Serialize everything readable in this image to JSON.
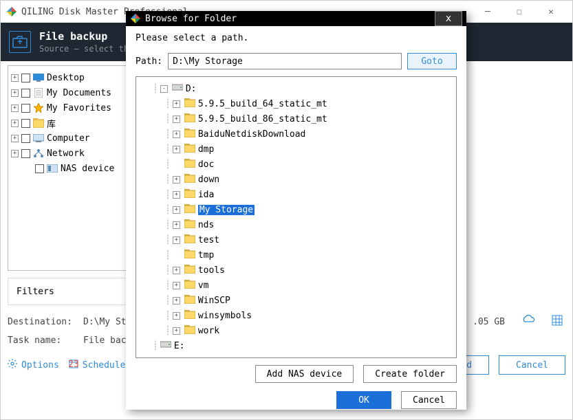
{
  "main": {
    "title": "QILING Disk Master Professional",
    "header_title": "File backup",
    "header_sub": "Source — select the files and folders you want to backup"
  },
  "left_tree": [
    {
      "expand": "+",
      "label": "Desktop",
      "icon": "desktop"
    },
    {
      "expand": "+",
      "label": "My Documents",
      "icon": "doc"
    },
    {
      "expand": "+",
      "label": "My Favorites",
      "icon": "star"
    },
    {
      "expand": "+",
      "label": "库",
      "icon": "lib"
    },
    {
      "expand": "+",
      "label": "Computer",
      "icon": "computer"
    },
    {
      "expand": "+",
      "label": "Network",
      "icon": "network"
    },
    {
      "expand": "",
      "label": "NAS device",
      "icon": "nas",
      "indent": true
    }
  ],
  "filters_label": "Filters",
  "dest": {
    "label": "Destination:",
    "value": "D:\\My Storage",
    "free": ".05 GB"
  },
  "task": {
    "label": "Task name:",
    "value": "File backup"
  },
  "bottom": {
    "options": "Options",
    "schedule": "Schedule",
    "proceed_partial": "eed",
    "cancel": "Cancel"
  },
  "dialog": {
    "title": "Browse for Folder",
    "prompt": "Please select a path.",
    "path_label": "Path:",
    "path_value": "D:\\My Storage",
    "goto": "Goto",
    "add_nas": "Add NAS device",
    "create_folder": "Create folder",
    "ok": "OK",
    "cancel": "Cancel"
  },
  "dlg_tree": {
    "drive_d": "D:",
    "children": [
      {
        "label": "5.9.5_build_64_static_mt",
        "exp": "+"
      },
      {
        "label": "5.9.5_build_86_static_mt",
        "exp": "+"
      },
      {
        "label": "BaiduNetdiskDownload",
        "exp": "+"
      },
      {
        "label": "dmp",
        "exp": "+"
      },
      {
        "label": "doc",
        "exp": ""
      },
      {
        "label": "down",
        "exp": "+"
      },
      {
        "label": "ida",
        "exp": "+"
      },
      {
        "label": "My Storage",
        "exp": "+",
        "selected": true
      },
      {
        "label": "nds",
        "exp": "+"
      },
      {
        "label": "test",
        "exp": "+"
      },
      {
        "label": "tmp",
        "exp": ""
      },
      {
        "label": "tools",
        "exp": "+"
      },
      {
        "label": "vm",
        "exp": "+"
      },
      {
        "label": "WinSCP",
        "exp": "+"
      },
      {
        "label": "winsymbols",
        "exp": "+"
      },
      {
        "label": "work",
        "exp": "+"
      }
    ],
    "drive_e": "E:"
  }
}
